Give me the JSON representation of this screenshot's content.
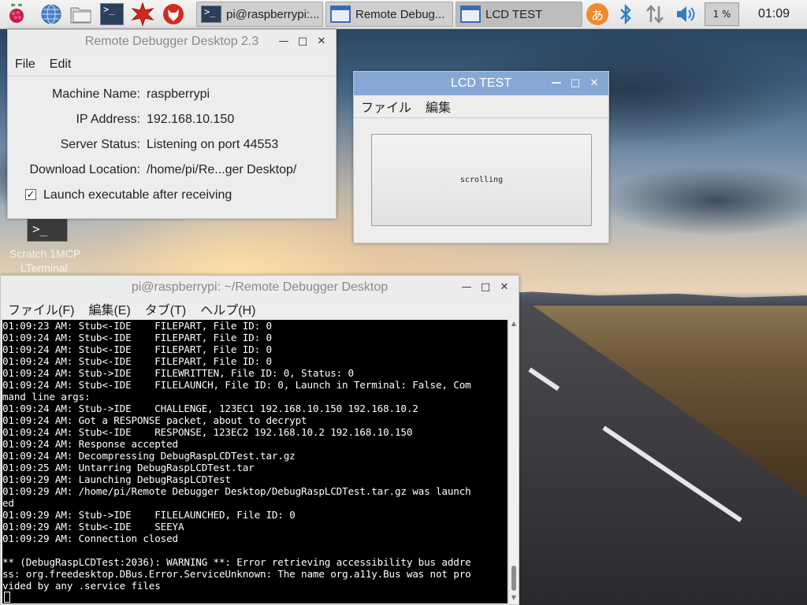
{
  "taskbar": {
    "launchers": [
      {
        "name": "raspberry-menu-icon"
      },
      {
        "name": "web-browser-icon"
      },
      {
        "name": "file-manager-icon"
      },
      {
        "name": "terminal-icon"
      },
      {
        "name": "mathematica-icon"
      },
      {
        "name": "wolfram-icon"
      }
    ],
    "tasks": [
      {
        "label": "pi@raspberrypi:...",
        "icon": "terminal-icon",
        "active": false
      },
      {
        "label": "Remote Debug...",
        "icon": "window-icon",
        "active": false
      },
      {
        "label": "LCD TEST",
        "icon": "window-icon",
        "active": true
      }
    ],
    "tray": {
      "input_method": "あ",
      "cpu_label": "1 %",
      "clock": "01:09"
    }
  },
  "desktop": {
    "icon_label_line1": "Scratch 1MCP",
    "icon_label_line2": "LTerminal"
  },
  "remote_debugger": {
    "title": "Remote Debugger Desktop 2.3",
    "menu": [
      "File",
      "Edit"
    ],
    "fields": [
      {
        "label": "Machine Name:",
        "value": "raspberrypi"
      },
      {
        "label": "IP Address:",
        "value": "192.168.10.150"
      },
      {
        "label": "Server Status:",
        "value": "Listening on port 44553"
      },
      {
        "label": "Download Location:",
        "value": "/home/pi/Re...ger Desktop/"
      }
    ],
    "checkbox_label": "Launch executable after receiving",
    "checkbox_checked": true
  },
  "lcd_test": {
    "title": "LCD TEST",
    "menu": [
      "ファイル",
      "編集"
    ],
    "button_label": "scrolling"
  },
  "terminal": {
    "title": "pi@raspberrypi: ~/Remote Debugger Desktop",
    "menu": [
      "ファイル(F)",
      "編集(E)",
      "タブ(T)",
      "ヘルプ(H)"
    ],
    "lines": [
      "01:09:23 AM: Stub<-IDE    FILEPART, File ID: 0",
      "01:09:24 AM: Stub<-IDE    FILEPART, File ID: 0",
      "01:09:24 AM: Stub<-IDE    FILEPART, File ID: 0",
      "01:09:24 AM: Stub<-IDE    FILEPART, File ID: 0",
      "01:09:24 AM: Stub->IDE    FILEWRITTEN, File ID: 0, Status: 0",
      "01:09:24 AM: Stub<-IDE    FILELAUNCH, File ID: 0, Launch in Terminal: False, Com",
      "mand line args:",
      "01:09:24 AM: Stub->IDE    CHALLENGE, 123EC1 192.168.10.150 192.168.10.2",
      "01:09:24 AM: Got a RESPONSE packet, about to decrypt",
      "01:09:24 AM: Stub<-IDE    RESPONSE, 123EC2 192.168.10.2 192.168.10.150",
      "01:09:24 AM: Response accepted",
      "01:09:24 AM: Decompressing DebugRaspLCDTest.tar.gz",
      "01:09:25 AM: Untarring DebugRaspLCDTest.tar",
      "01:09:29 AM: Launching DebugRaspLCDTest",
      "01:09:29 AM: /home/pi/Remote Debugger Desktop/DebugRaspLCDTest.tar.gz was launch",
      "ed",
      "01:09:29 AM: Stub->IDE    FILELAUNCHED, File ID: 0",
      "01:09:29 AM: Stub<-IDE    SEEYA",
      "01:09:29 AM: Connection closed",
      "",
      "** (DebugRaspLCDTest:2036): WARNING **: Error retrieving accessibility bus addre",
      "ss: org.freedesktop.DBus.Error.ServiceUnknown: The name org.a11y.Bus was not pro",
      "vided by any .service files",
      ""
    ]
  }
}
